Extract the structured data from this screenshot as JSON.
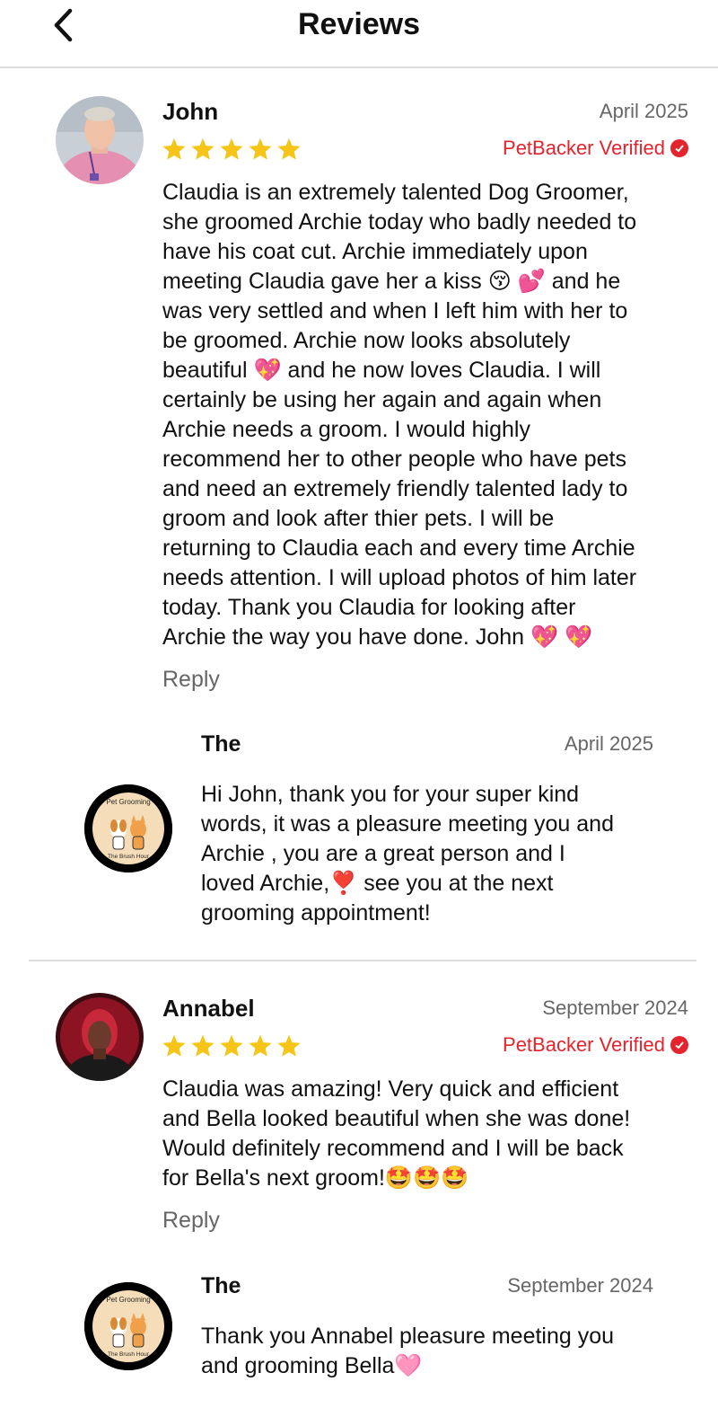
{
  "header": {
    "title": "Reviews",
    "back_icon": "chevron-left-icon"
  },
  "reviews": [
    {
      "name": "John",
      "date": "April 2025",
      "rating": 5,
      "verified_label": "PetBacker Verified",
      "text": "Claudia is an extremely talented Dog Groomer,\nshe groomed Archie today who badly needed to\nhave his coat cut. Archie immediately upon\nmeeting Claudia gave her a kiss 😚 💕 and he\nwas very settled and when I left him with her to\nbe groomed. Archie now looks absolutely\nbeautiful 💖 and he now loves Claudia. I will\ncertainly be using her again and again when\nArchie needs a groom. I would highly\nrecommend her to other people who have pets\nand need an extremely friendly talented lady to\ngroom and look after thier pets. I will be\nreturning to Claudia each and every time Archie\nneeds attention. I will upload photos of him later\ntoday. Thank you Claudia for looking after\nArchie the way you have done. John 💖 💖",
      "reply_label": "Reply",
      "response": {
        "name": "The",
        "date": "April 2025",
        "text": "Hi John, thank you for your super kind\nwords, it was a pleasure meeting you and\nArchie , you are a great person and I\nloved Archie,❣️ see you at the next\ngrooming appointment!"
      }
    },
    {
      "name": "Annabel",
      "date": "September 2024",
      "rating": 5,
      "verified_label": "PetBacker Verified",
      "text": "Claudia was amazing! Very quick and efficient\nand Bella looked beautiful when she was done!\nWould definitely recommend and I will be back\nfor Bella's next groom!🤩🤩🤩",
      "reply_label": "Reply",
      "response": {
        "name": "The",
        "date": "September 2024",
        "text": "Thank you Annabel pleasure meeting you\nand grooming Bella🩷"
      }
    }
  ],
  "business_logo": {
    "line1": "Pet Grooming",
    "line2": "The Brush Hour"
  },
  "colors": {
    "star": "#f5c518",
    "verified": "#e4232d",
    "muted": "#666666",
    "divider": "#dcdcdc"
  }
}
